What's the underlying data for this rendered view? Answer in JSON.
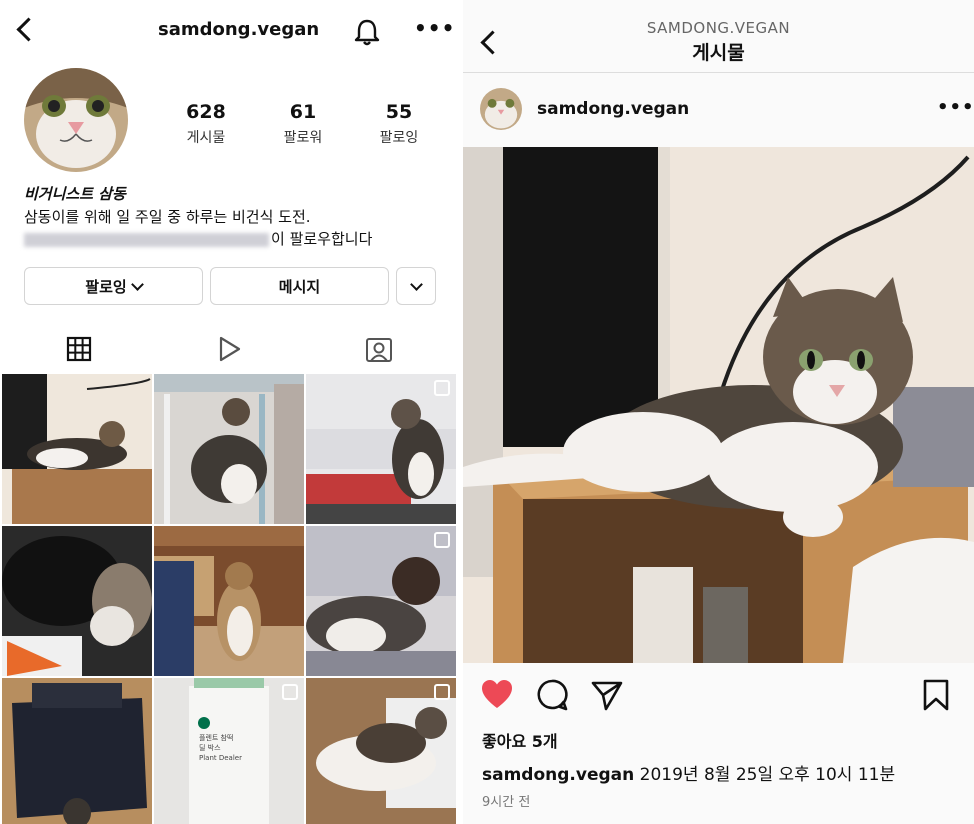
{
  "profile": {
    "username": "samdong.vegan",
    "stats": [
      {
        "num": "628",
        "label": "게시물"
      },
      {
        "num": "61",
        "label": "팔로워"
      },
      {
        "num": "55",
        "label": "팔로잉"
      }
    ],
    "bio_name": "비거니스트 삼동",
    "bio_desc": "삼동이를 위해 일 주일 중 하루는 비건식 도전.",
    "followed_by_suffix": "이 팔로우합니다",
    "buttons": {
      "following": "팔로잉",
      "message": "메시지"
    },
    "grid": [
      {
        "id": "post-1",
        "multi": false
      },
      {
        "id": "post-2",
        "multi": false
      },
      {
        "id": "post-3",
        "multi": true
      },
      {
        "id": "post-4",
        "multi": false
      },
      {
        "id": "post-5",
        "multi": false
      },
      {
        "id": "post-6",
        "multi": true
      },
      {
        "id": "post-7",
        "multi": false
      },
      {
        "id": "post-8",
        "multi": true
      },
      {
        "id": "post-9",
        "multi": true
      }
    ],
    "receipt_text": [
      "플렌트 참떡",
      "딜 박스",
      "Plant Dealer"
    ]
  },
  "post": {
    "header_sub": "SAMDONG.VEGAN",
    "header_title": "게시물",
    "username": "samdong.vegan",
    "likes": "좋아요 5개",
    "caption_user": "samdong.vegan",
    "caption_text": " 2019년 8월 25일 오후 10시 11분",
    "time_ago": "9시간 전"
  },
  "colors": {
    "like": "#ed4956",
    "text": "#262626",
    "muted": "#8e8e8e"
  },
  "icons": [
    "back-icon",
    "bell-icon",
    "more-icon",
    "grid-icon",
    "reels-icon",
    "tagged-icon",
    "heart-icon",
    "comment-icon",
    "share-icon",
    "bookmark-icon"
  ]
}
